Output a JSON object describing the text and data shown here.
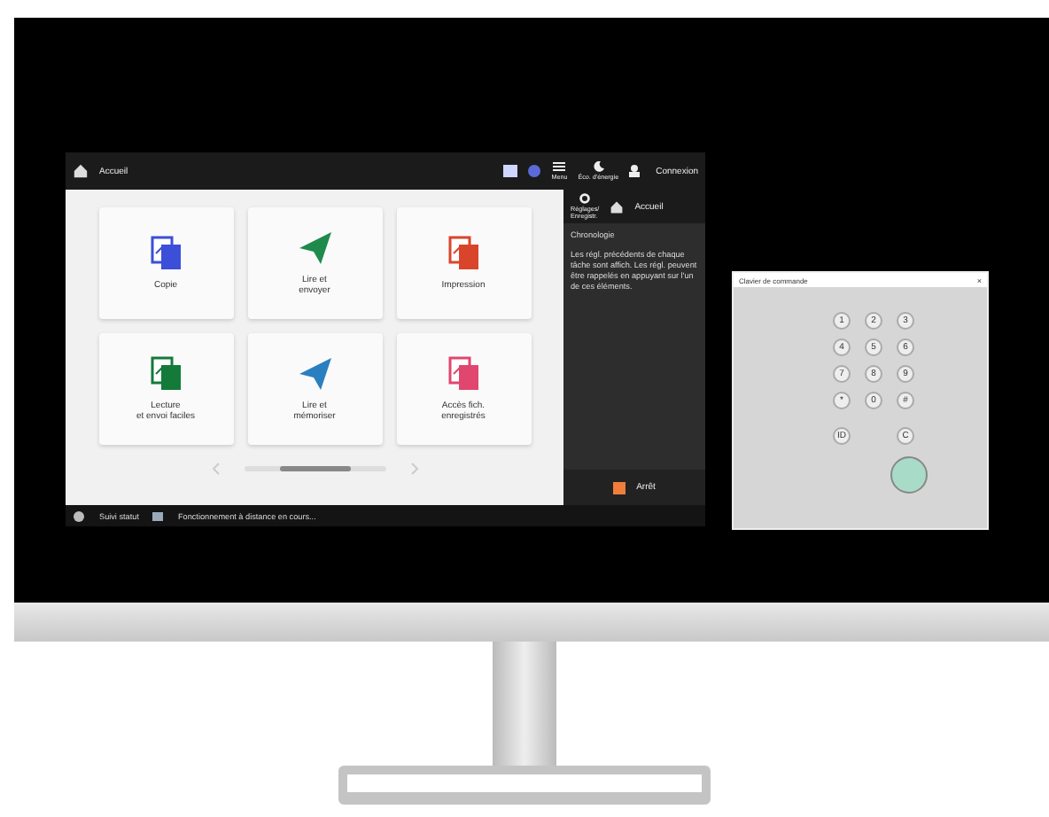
{
  "header": {
    "title": "Accueil",
    "menu": "Menu",
    "energy": "Éco. d'énergie",
    "login": "Connexion"
  },
  "tiles": [
    {
      "label": "Copie",
      "color": "#3b4fd8"
    },
    {
      "label": "Lire et\nenvoyer",
      "color": "#1f8a4c"
    },
    {
      "label": "Impression",
      "color": "#d9452b"
    },
    {
      "label": "Lecture\net envoi faciles",
      "color": "#137a3a"
    },
    {
      "label": "Lire et\nmémoriser",
      "color": "#2a7fc1"
    },
    {
      "label": "Accès fich.\nenregistrés",
      "color": "#e0466e"
    }
  ],
  "side": {
    "settings": "Réglages/\nEnregistr.",
    "home": "Accueil",
    "heading": "Chronologie",
    "text": "Les régl. précédents de chaque tâche sont affich. Les régl. peuvent être rappelés en appuyant sur l'un de ces éléments.",
    "stop": "Arrêt"
  },
  "status": {
    "monitor": "Suivi statut",
    "message": "Fonctionnement à distance en cours..."
  },
  "keypad": {
    "title": "Clavier de commande",
    "close": "×",
    "keys": [
      "1",
      "2",
      "3",
      "4",
      "5",
      "6",
      "7",
      "8",
      "9",
      "*",
      "0",
      "#"
    ],
    "id": "ID",
    "clear": "C"
  }
}
